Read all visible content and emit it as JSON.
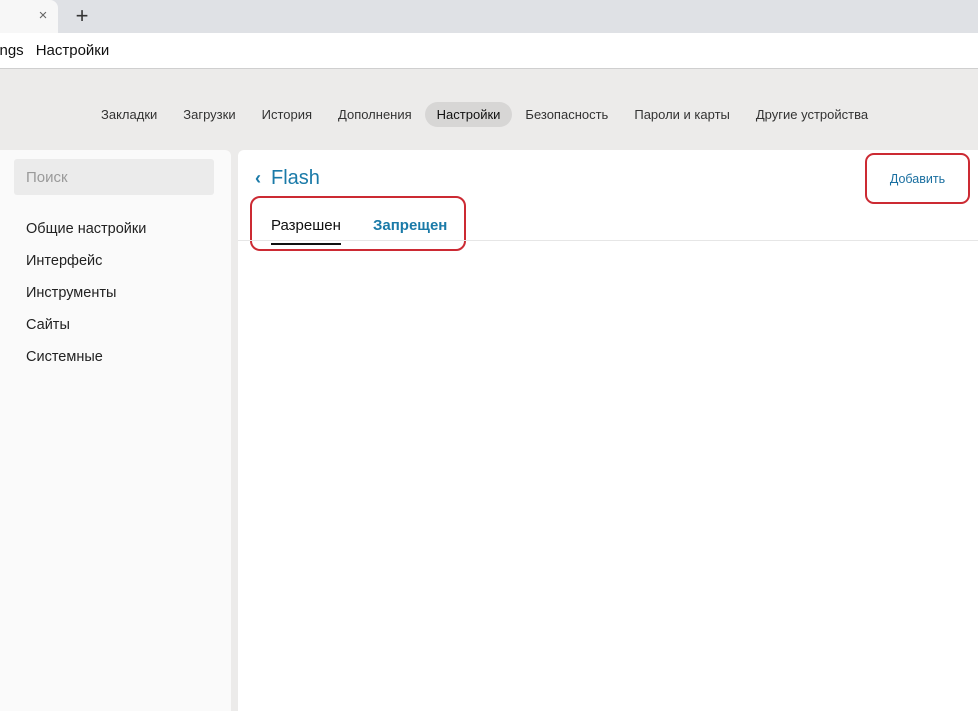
{
  "browser": {
    "tab_close_glyph": "×",
    "new_tab_glyph": "+",
    "address_url_fragment": "tings",
    "address_page_title": "Настройки"
  },
  "topnav": {
    "items": [
      {
        "label": "Закладки"
      },
      {
        "label": "Загрузки"
      },
      {
        "label": "История"
      },
      {
        "label": "Дополнения"
      },
      {
        "label": "Настройки",
        "active": true
      },
      {
        "label": "Безопасность"
      },
      {
        "label": "Пароли и карты"
      },
      {
        "label": "Другие устройства"
      }
    ]
  },
  "sidebar": {
    "search_placeholder": "Поиск",
    "items": [
      {
        "label": "Общие настройки"
      },
      {
        "label": "Интерфейс"
      },
      {
        "label": "Инструменты"
      },
      {
        "label": "Сайты"
      },
      {
        "label": "Системные"
      }
    ]
  },
  "main": {
    "back_glyph": "‹",
    "title": "Flash",
    "add_label": "Добавить",
    "tabs": [
      {
        "label": "Разрешен",
        "active": true
      },
      {
        "label": "Запрещен"
      }
    ]
  },
  "colors": {
    "accent_link": "#1a7aa8",
    "highlight_red": "#cc2a33",
    "page_bg": "#ecebea"
  }
}
